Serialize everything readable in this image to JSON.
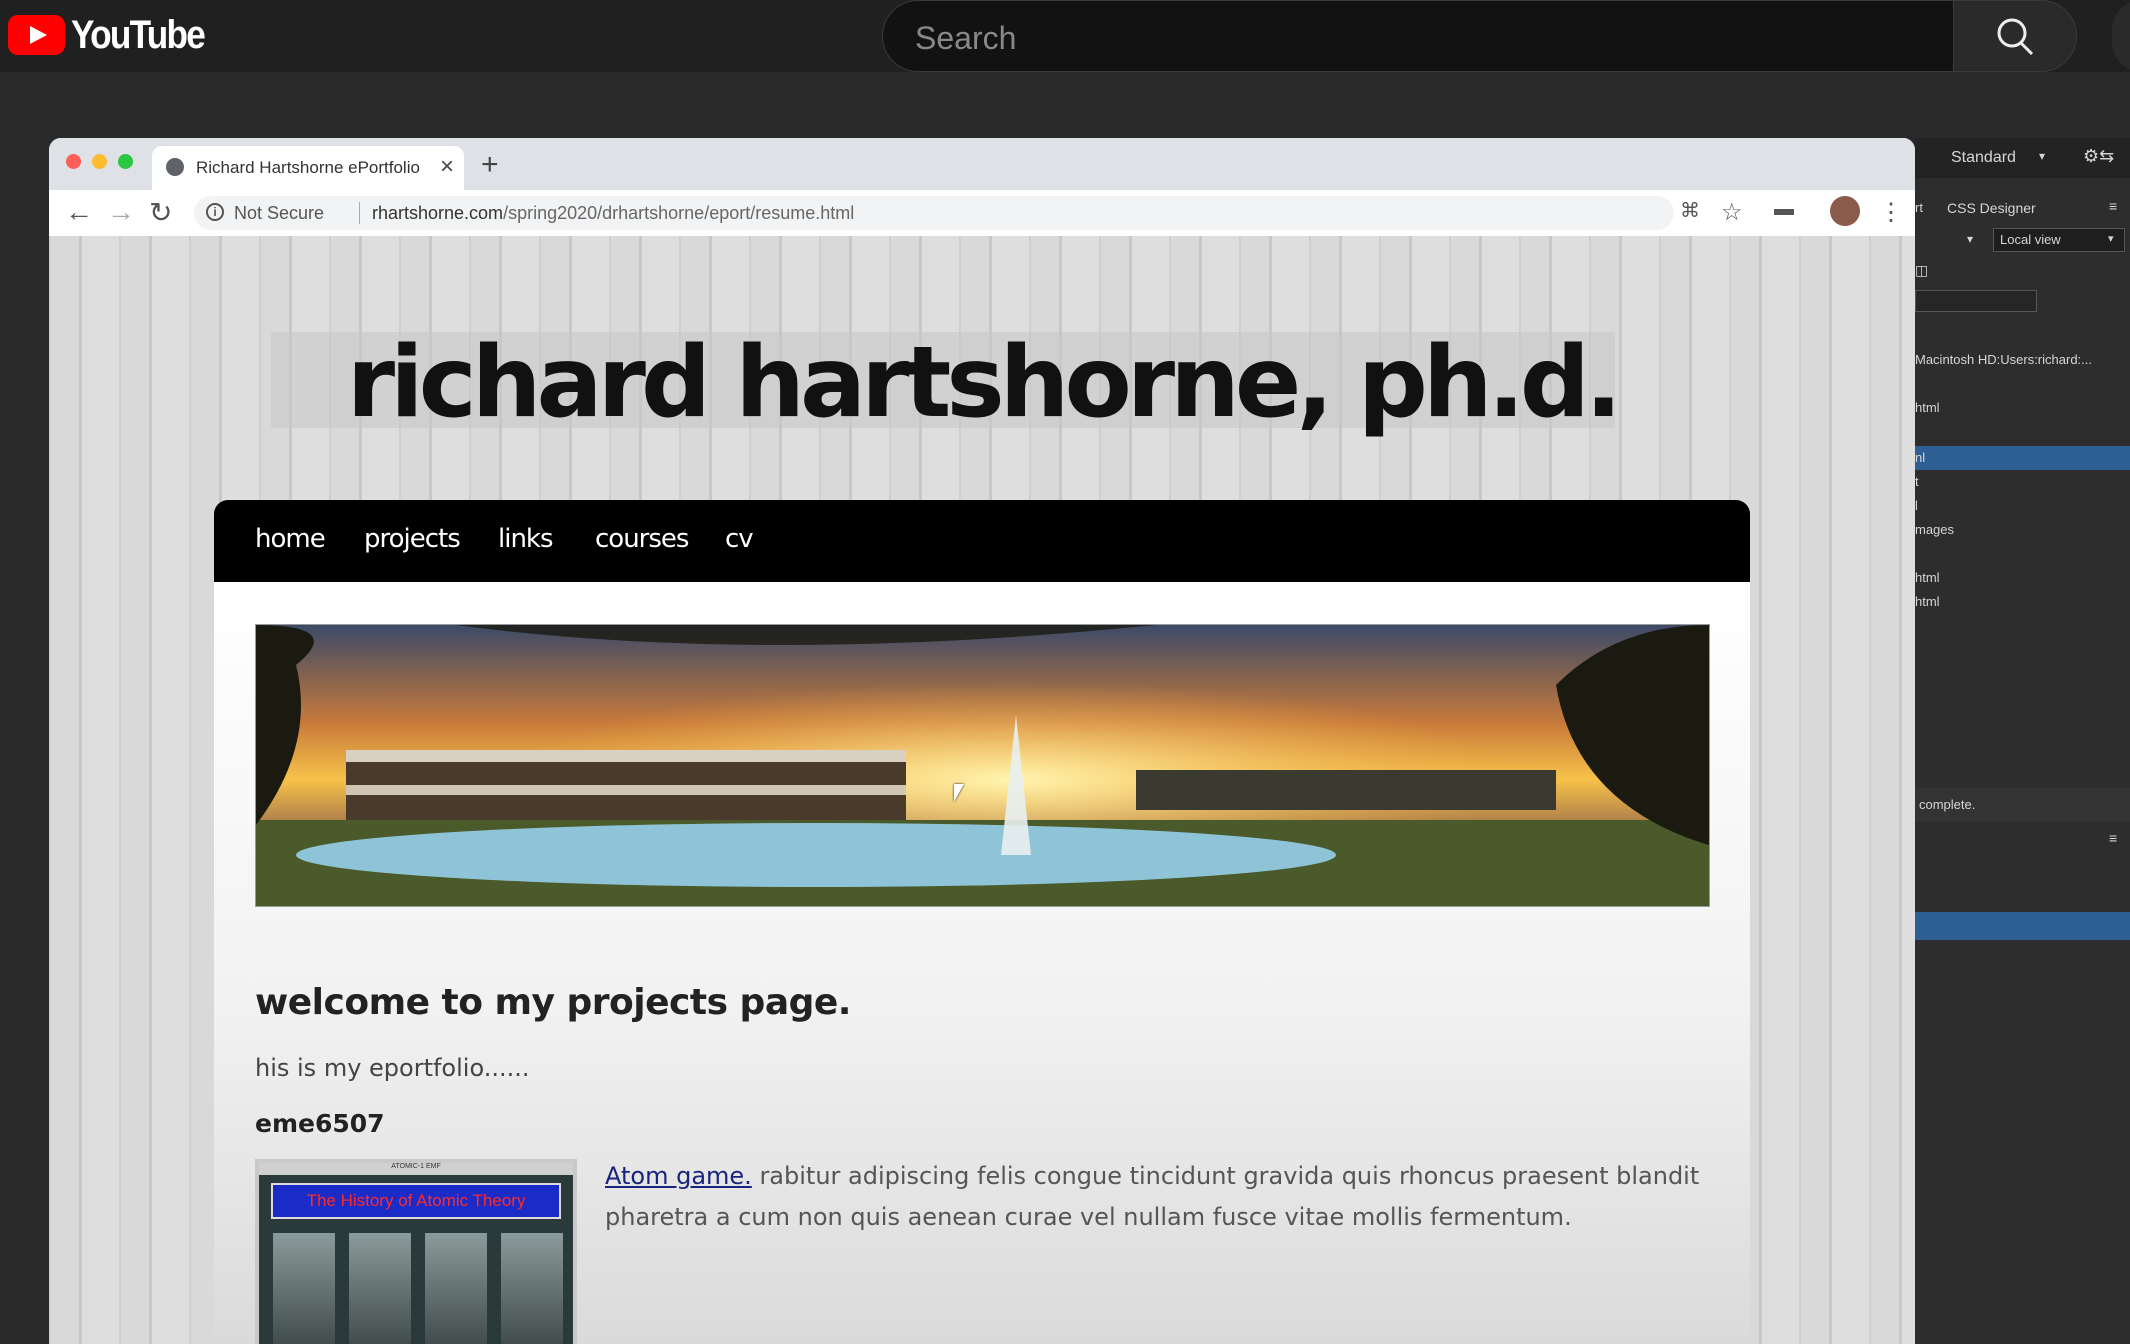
{
  "youtube": {
    "logo_text": "YouTube",
    "search_placeholder": "Search"
  },
  "browser": {
    "tab_title": "Richard Hartshorne ePortfolio",
    "security_label": "Not Secure",
    "url_domain": "rhartshorne.com",
    "url_path": "/spring2020/drhartshorne/eport/resume.html"
  },
  "site": {
    "title": "richard hartshorne, ph.d.",
    "nav": [
      "home",
      "projects",
      "links",
      "courses",
      "cv"
    ],
    "welcome": "welcome to my projects page.",
    "intro": "his is my eportfolio......",
    "course_code": "eme6507",
    "project": {
      "link_text": "Atom game.",
      "description": " rabitur adipiscing felis congue tincidunt gravida quis rhoncus praesent blandit pharetra a cum non quis aenean curae vel nullam fusce vitae mollis fermentum.",
      "thumb_header": "ATOMIC-1 EMF",
      "thumb_title": "The History of Atomic Theory"
    }
  },
  "panel": {
    "view_mode": "Standard",
    "tab_partial": "rt",
    "tab_css": "CSS Designer",
    "view_select": "Local view",
    "path_text": "Macintosh HD:Users:richard:...",
    "items": [
      "html",
      "nl",
      "t",
      "l",
      "mages",
      "html",
      "html"
    ],
    "status": "complete."
  },
  "colors": {
    "yt_red": "#ff0000",
    "nav_bg": "#000000",
    "link": "#1a237e",
    "panel_highlight": "#2e5f94"
  }
}
